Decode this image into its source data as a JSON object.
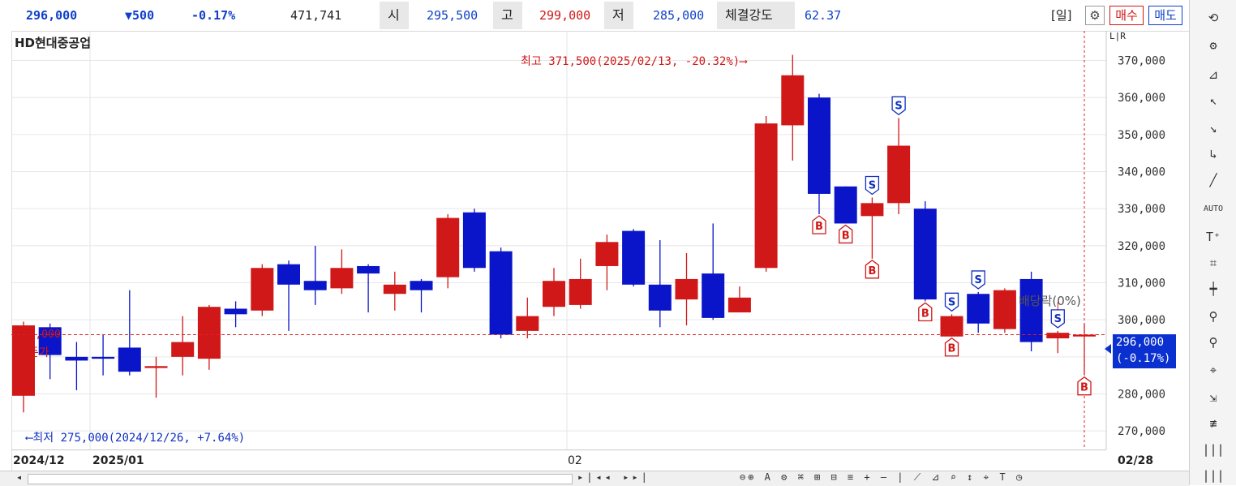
{
  "topbar": {
    "price": "296,000",
    "change": "▼500",
    "pct": "-0.17%",
    "volume": "471,741",
    "open_label": "시",
    "open": "295,500",
    "high_label": "고",
    "high": "299,000",
    "low_label": "저",
    "low": "285,000",
    "strength_label": "체결강도",
    "strength": "62.37",
    "period": "[일]",
    "buy": "매수",
    "sell": "매도"
  },
  "chart_title": "HD현대중공업",
  "scale_toggle": "L|R",
  "annotations": {
    "high": "최고 371,500(2025/02/13, -20.32%)⟶",
    "low": "⟵최저 275,000(2024/12/26, +7.64%)",
    "dividend": "배당락(0%)",
    "prev_price": "296,000",
    "prev_label": "기준가",
    "current_price": "296,000",
    "current_pct": "(-0.17%)"
  },
  "x_labels": [
    "2024/12",
    "2025/01",
    "02",
    "02/28"
  ],
  "colors": {
    "up": "#d01818",
    "down": "#0a14c8"
  },
  "chart_data": {
    "type": "candlestick",
    "title": "HD현대중공업",
    "ylim": [
      265000,
      378000
    ],
    "y_ticks": [
      270000,
      280000,
      290000,
      300000,
      310000,
      320000,
      330000,
      340000,
      350000,
      360000,
      370000
    ],
    "y_tick_labels": [
      "270,000",
      "280,000",
      "290,000",
      "300,000",
      "310,000",
      "320,000",
      "330,000",
      "340,000",
      "350,000",
      "360,000",
      "370,000"
    ],
    "candles": [
      {
        "o": 279500,
        "c": 298500,
        "h": 299500,
        "l": 275000
      },
      {
        "o": 298000,
        "c": 290500,
        "h": 299000,
        "l": 284000
      },
      {
        "o": 290000,
        "c": 289000,
        "h": 294000,
        "l": 281000
      },
      {
        "o": 290000,
        "c": 289500,
        "h": 296000,
        "l": 285000
      },
      {
        "o": 292500,
        "c": 286000,
        "h": 308000,
        "l": 285000
      },
      {
        "o": 287000,
        "c": 287500,
        "h": 290000,
        "l": 279000
      },
      {
        "o": 290000,
        "c": 294000,
        "h": 301000,
        "l": 285000
      },
      {
        "o": 289500,
        "c": 303500,
        "h": 304000,
        "l": 286500
      },
      {
        "o": 303000,
        "c": 301500,
        "h": 305000,
        "l": 298000
      },
      {
        "o": 302500,
        "c": 314000,
        "h": 315000,
        "l": 301000
      },
      {
        "o": 315000,
        "c": 309500,
        "h": 316000,
        "l": 297000
      },
      {
        "o": 310500,
        "c": 308000,
        "h": 320000,
        "l": 304000
      },
      {
        "o": 308500,
        "c": 314000,
        "h": 319000,
        "l": 307000
      },
      {
        "o": 314500,
        "c": 312500,
        "h": 315000,
        "l": 302000
      },
      {
        "o": 307000,
        "c": 309500,
        "h": 313000,
        "l": 302500
      },
      {
        "o": 310500,
        "c": 308000,
        "h": 311000,
        "l": 302000
      },
      {
        "o": 311500,
        "c": 327500,
        "h": 328500,
        "l": 308500
      },
      {
        "o": 329000,
        "c": 314000,
        "h": 330000,
        "l": 313000
      },
      {
        "o": 318500,
        "c": 296000,
        "h": 319500,
        "l": 295000
      },
      {
        "o": 297000,
        "c": 301000,
        "h": 306000,
        "l": 295000
      },
      {
        "o": 303500,
        "c": 310500,
        "h": 314000,
        "l": 301000
      },
      {
        "o": 304000,
        "c": 311000,
        "h": 316500,
        "l": 303000
      },
      {
        "o": 314500,
        "c": 321000,
        "h": 323000,
        "l": 308000
      },
      {
        "o": 324000,
        "c": 309500,
        "h": 324500,
        "l": 309000
      },
      {
        "o": 309500,
        "c": 302500,
        "h": 321500,
        "l": 298000
      },
      {
        "o": 305500,
        "c": 311000,
        "h": 318000,
        "l": 298500
      },
      {
        "o": 312500,
        "c": 300500,
        "h": 326000,
        "l": 300000
      },
      {
        "o": 302000,
        "c": 306000,
        "h": 309000,
        "l": 302000
      },
      {
        "o": 314000,
        "c": 353000,
        "h": 355000,
        "l": 313000
      },
      {
        "o": 352500,
        "c": 366000,
        "h": 371500,
        "l": 343000
      },
      {
        "o": 360000,
        "c": 334000,
        "h": 361000,
        "l": 328500
      },
      {
        "o": 336000,
        "c": 326000,
        "h": 336000,
        "l": 326000
      },
      {
        "o": 328000,
        "c": 331500,
        "h": 333000,
        "l": 316500
      },
      {
        "o": 331500,
        "c": 347000,
        "h": 354500,
        "l": 328500
      },
      {
        "o": 330000,
        "c": 305500,
        "h": 332000,
        "l": 305000
      },
      {
        "o": 295500,
        "c": 301000,
        "h": 301500,
        "l": 295500
      },
      {
        "o": 307000,
        "c": 299000,
        "h": 307500,
        "l": 296500
      },
      {
        "o": 297500,
        "c": 308000,
        "h": 308500,
        "l": 296500
      },
      {
        "o": 311000,
        "c": 294000,
        "h": 313000,
        "l": 291500
      },
      {
        "o": 295000,
        "c": 296500,
        "h": 297000,
        "l": 291000
      },
      {
        "o": 295500,
        "c": 296000,
        "h": 299000,
        "l": 285000
      }
    ],
    "signals": [
      {
        "i": 30,
        "t": "B"
      },
      {
        "i": 31,
        "t": "B"
      },
      {
        "i": 32,
        "t": "S"
      },
      {
        "i": 32,
        "t": "B"
      },
      {
        "i": 33,
        "t": "S"
      },
      {
        "i": 34,
        "t": "B"
      },
      {
        "i": 35,
        "t": "S"
      },
      {
        "i": 35,
        "t": "B"
      },
      {
        "i": 36,
        "t": "S"
      },
      {
        "i": 39,
        "t": "S"
      },
      {
        "i": 40,
        "t": "B"
      }
    ]
  }
}
